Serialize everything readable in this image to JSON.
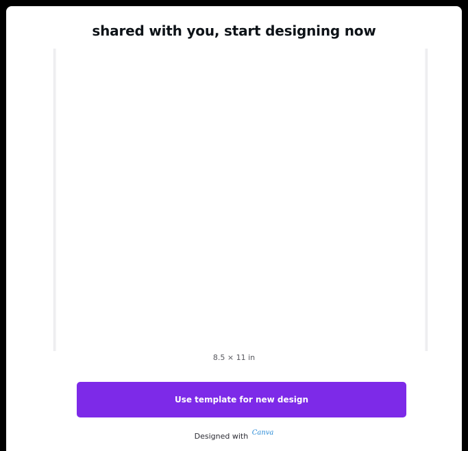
{
  "header": {
    "title": "shared with you, start designing now"
  },
  "preview": {
    "size_label": "8.5 × 11 in"
  },
  "actions": {
    "use_template_label": "Use template for new design"
  },
  "footer": {
    "designed_with": "Designed with",
    "brand": "Canva"
  },
  "colors": {
    "accent": "#7d2ae8",
    "background": "#000000",
    "card": "#ffffff"
  }
}
